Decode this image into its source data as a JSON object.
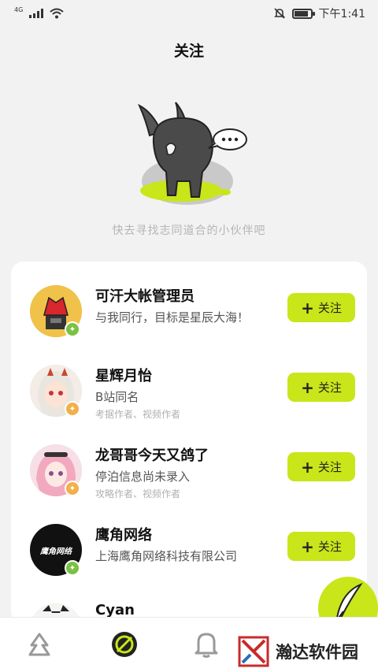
{
  "status_bar": {
    "network": "4G",
    "time": "下午1:41",
    "battery_level": 0.85
  },
  "header": {
    "title": "关注",
    "tagline": "快去寻找志同道合的小伙伴吧"
  },
  "follow_button_label": "关注",
  "users": [
    {
      "name": "可汗大帐管理员",
      "desc": "与我同行，目标是星辰大海！",
      "tags": "",
      "badge_color": "#7ac143"
    },
    {
      "name": "星辉月怡",
      "desc": "B站同名",
      "tags": "考据作者、视频作者",
      "badge_color": "#f2b04a"
    },
    {
      "name": "龙哥哥今天又鸽了",
      "desc": "停泊信息尚未录入",
      "tags": "攻略作者、视频作者",
      "badge_color": "#f2b04a"
    },
    {
      "name": "鹰角网络",
      "desc": "上海鹰角网络科技有限公司",
      "tags": "",
      "badge_color": "#7ac143"
    },
    {
      "name": "Cyan",
      "desc": "",
      "tags": "",
      "badge_color": "#7ac143"
    }
  ],
  "avatars": {
    "hawk_logo_text": "鹰角网络"
  },
  "colors": {
    "accent": "#c8e619",
    "background": "#f2f2f2"
  },
  "icons": [
    "signal-icon",
    "wifi-icon",
    "mute-bell-icon",
    "battery-icon",
    "feather-icon",
    "home-nav-icon",
    "discover-nav-icon",
    "notification-nav-icon"
  ],
  "watermark": {
    "text": "瀚达软件园"
  }
}
